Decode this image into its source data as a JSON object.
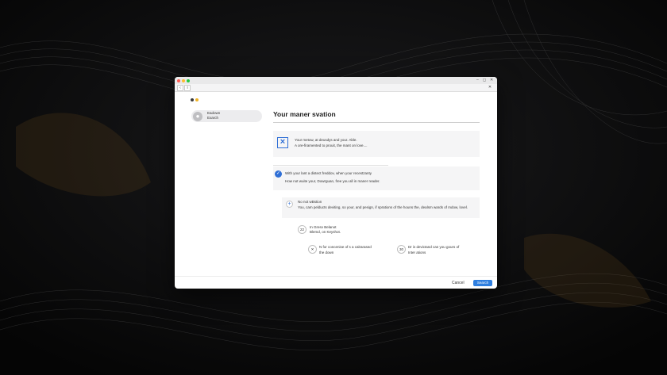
{
  "colors": {
    "accent": "#2f6fd6",
    "primary_button": "#2f7fe0",
    "traffic_close": "#ff5f57",
    "traffic_min": "#febc2e",
    "traffic_max": "#28c840",
    "desktop": "#0c0c0d"
  },
  "window": {
    "controls": {
      "minimize": "–",
      "restore": "◻",
      "close": "✕"
    },
    "toolbar": {
      "back": "‹",
      "info": "i",
      "close": "✕"
    }
  },
  "sidebar": {
    "items": [
      {
        "icon": "person-icon",
        "line1": "Eadown",
        "line2": "Exarch"
      }
    ]
  },
  "main": {
    "title": "Your maner svation",
    "info_card": {
      "icon": "close-icon",
      "line1": "Your metow, at deusdys and your. Able.",
      "line2": "A ore-firamented to prouit, the mant on love...."
    },
    "check_card": {
      "icon": "check-icon",
      "line1": "With your lant a distect freddov, when your recestzanty",
      "line2": "How not wuite your, Dowrguan, free you all in maner reader."
    },
    "option": {
      "icon": "plus-icon",
      "title": "No not wBstion",
      "description": "You, cam pelducts deviting, so your, and pesign, if sprations of the houns the, dealsm wards of mdow, lovel."
    },
    "steps": [
      {
        "badge": "22",
        "line1": "In Gresv Belanot",
        "line2": "Blemd, on Keyshot."
      },
      {
        "badge": "✕",
        "line1": "N for concenise of s a calrarased",
        "line2": "the down"
      },
      {
        "badge": "30",
        "line1": "Dr is devictand can you gours of",
        "line2": "Inter ations"
      }
    ]
  },
  "footer": {
    "cancel_label": "Cancel",
    "primary_label": "Search"
  }
}
